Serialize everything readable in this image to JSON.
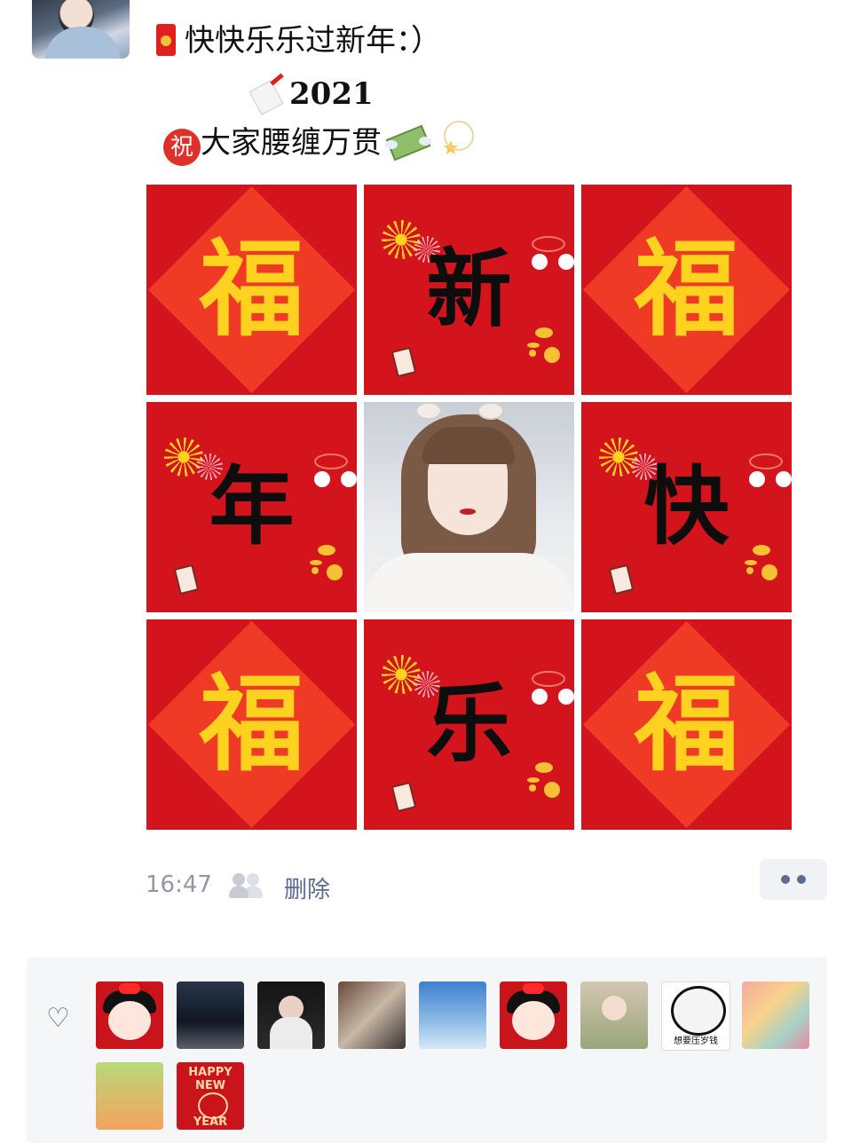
{
  "post": {
    "line1": "快快乐乐过新年：）",
    "line2": "2021",
    "line3": "大家腰缠万贯",
    "zhu_char": "祝"
  },
  "grid": {
    "tiles": [
      {
        "char": "福",
        "kind": "fu"
      },
      {
        "char": "新",
        "kind": "word"
      },
      {
        "char": "福",
        "kind": "fu"
      },
      {
        "char": "年",
        "kind": "word"
      },
      {
        "char": "",
        "kind": "photo"
      },
      {
        "char": "快",
        "kind": "word"
      },
      {
        "char": "福",
        "kind": "fu"
      },
      {
        "char": "乐",
        "kind": "word"
      },
      {
        "char": "福",
        "kind": "fu"
      }
    ]
  },
  "meta": {
    "time": "16:47",
    "delete_label": "删除"
  },
  "likes": {
    "avatars": [
      {
        "name": "avatar-maruko-1"
      },
      {
        "name": "avatar-night-river"
      },
      {
        "name": "avatar-dark-portrait"
      },
      {
        "name": "avatar-cafe-group"
      },
      {
        "name": "avatar-blue-illustration"
      },
      {
        "name": "avatar-maruko-2"
      },
      {
        "name": "avatar-girl-portrait"
      },
      {
        "name": "avatar-panda-meme"
      },
      {
        "name": "avatar-colorful-collage"
      },
      {
        "name": "avatar-cartoon-kids"
      },
      {
        "name": "avatar-happy-new-year"
      }
    ],
    "panda_caption": "想要压岁钱",
    "happy_text": "HAPPY NEW",
    "year_text": "YEAR"
  },
  "colors": {
    "tile_red": "#d3141c",
    "fu_gold": "#ffd21f",
    "link_blue": "#5b6b92"
  }
}
